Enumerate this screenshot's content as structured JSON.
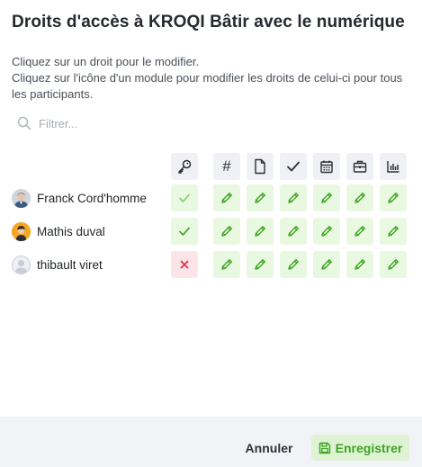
{
  "dialog": {
    "title": "Droits d'accès à KROQI Bâtir avec le numérique",
    "instruction_line1": "Cliquez sur un droit pour le modifier.",
    "instruction_line2": "Cliquez sur l'icône d'un module pour modifier les droits de celui-ci pour tous les participants."
  },
  "filter": {
    "placeholder": "Filtrer..."
  },
  "columns": [
    {
      "icon": "key-icon"
    },
    {
      "icon": "hash-icon",
      "label": "#"
    },
    {
      "icon": "document-icon"
    },
    {
      "icon": "check-icon"
    },
    {
      "icon": "calendar-icon"
    },
    {
      "icon": "briefcase-icon"
    },
    {
      "icon": "bar-chart-icon"
    }
  ],
  "participants": [
    {
      "name": "Franck Cord'homme",
      "avatar": "photo",
      "access": "granted-light"
    },
    {
      "name": "Mathis duval",
      "avatar": "illustrated",
      "access": "granted"
    },
    {
      "name": "thibault viret",
      "avatar": "default",
      "access": "denied"
    }
  ],
  "footer": {
    "cancel_label": "Annuler",
    "save_label": "Enregistrer"
  },
  "colors": {
    "granted": "#3fa524",
    "granted_bg": "#e9f8e0",
    "denied": "#e0354e",
    "denied_bg": "#fde4e8",
    "header_bg": "#eff1f5"
  }
}
